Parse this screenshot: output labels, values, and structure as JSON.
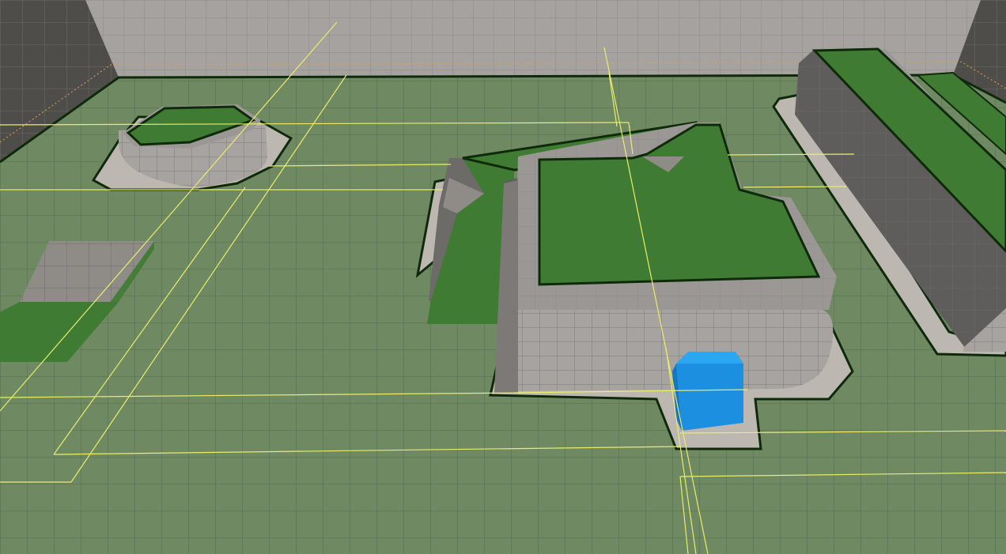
{
  "viewport": {
    "view": "perspective",
    "mode": "navigation-mesh-debug"
  },
  "colors": {
    "floor": "#6f8962",
    "floor_grid": "#5a7050",
    "navmesh": "#3f7b33",
    "navmesh_outline": "#0f2a0a",
    "wall_top": "#9b9794",
    "wall_light": "#a6a3a1",
    "wall_dark": "#5f5d5b",
    "wall_grid": "#7e7b79",
    "far_wall": "#a6a2a0",
    "far_wall_dark": "#55544f",
    "bounds_line": "#e8ed6b",
    "cube": "#1d8fe0",
    "cube_top": "#2aa7f0",
    "cube_side": "#1576c7",
    "ground_skirt": "#bdb7b1"
  },
  "objects": [
    {
      "name": "floor",
      "kind": "ground-plane"
    },
    {
      "name": "back-wall",
      "kind": "wall"
    },
    {
      "name": "left-wall",
      "kind": "wall"
    },
    {
      "name": "octagon-platform",
      "kind": "platform"
    },
    {
      "name": "ramp-block",
      "kind": "ramp"
    },
    {
      "name": "central-building",
      "kind": "building"
    },
    {
      "name": "long-wall-block",
      "kind": "wall"
    },
    {
      "name": "player-cube",
      "kind": "cube"
    },
    {
      "name": "nav-bounds-lines",
      "kind": "debug-lines"
    }
  ]
}
